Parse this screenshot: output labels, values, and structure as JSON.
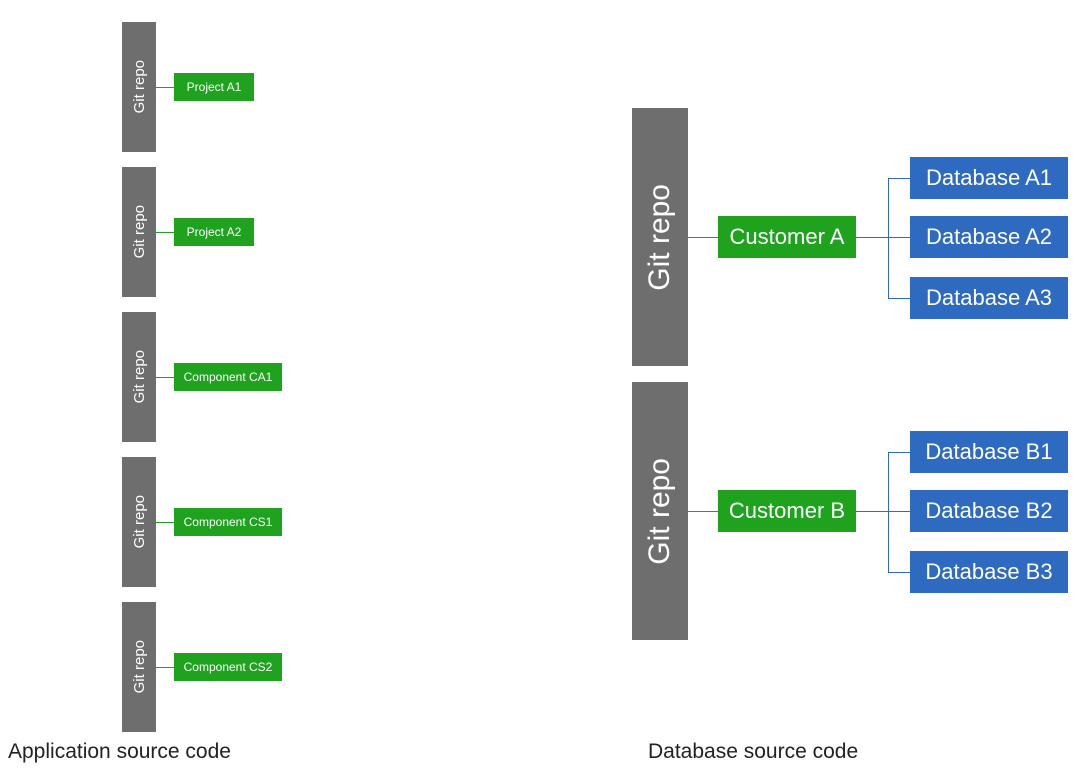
{
  "labels": {
    "git_repo": "Git repo",
    "app_caption": "Application source code",
    "db_caption": "Database source code"
  },
  "left": {
    "repos": [
      {
        "item": "Project A1"
      },
      {
        "item": "Project A2"
      },
      {
        "item": "Component CA1"
      },
      {
        "item": "Component CS1"
      },
      {
        "item": "Component CS2"
      }
    ]
  },
  "right": {
    "repos": [
      {
        "customer": "Customer A",
        "databases": [
          "Database A1",
          "Database A2",
          "Database A3"
        ]
      },
      {
        "customer": "Customer B",
        "databases": [
          "Database B1",
          "Database B2",
          "Database B3"
        ]
      }
    ]
  }
}
